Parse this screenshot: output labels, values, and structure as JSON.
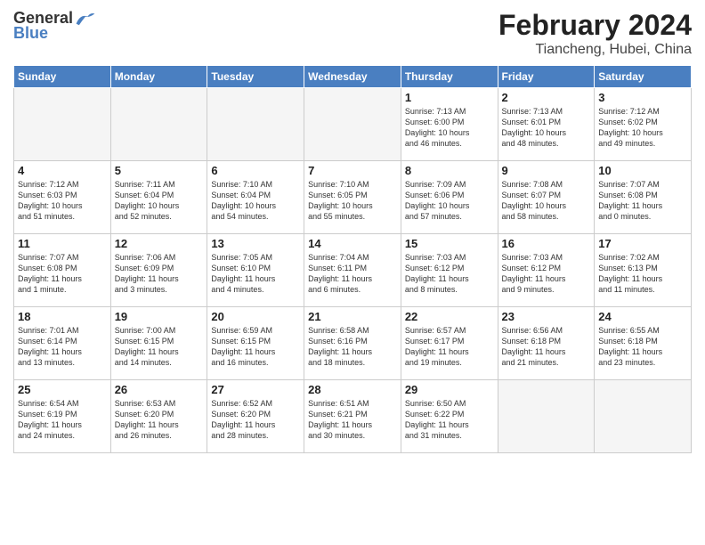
{
  "header": {
    "logo_general": "General",
    "logo_blue": "Blue",
    "month_title": "February 2024",
    "location": "Tiancheng, Hubei, China"
  },
  "weekdays": [
    "Sunday",
    "Monday",
    "Tuesday",
    "Wednesday",
    "Thursday",
    "Friday",
    "Saturday"
  ],
  "weeks": [
    [
      {
        "day": "",
        "info": ""
      },
      {
        "day": "",
        "info": ""
      },
      {
        "day": "",
        "info": ""
      },
      {
        "day": "",
        "info": ""
      },
      {
        "day": "1",
        "info": "Sunrise: 7:13 AM\nSunset: 6:00 PM\nDaylight: 10 hours\nand 46 minutes."
      },
      {
        "day": "2",
        "info": "Sunrise: 7:13 AM\nSunset: 6:01 PM\nDaylight: 10 hours\nand 48 minutes."
      },
      {
        "day": "3",
        "info": "Sunrise: 7:12 AM\nSunset: 6:02 PM\nDaylight: 10 hours\nand 49 minutes."
      }
    ],
    [
      {
        "day": "4",
        "info": "Sunrise: 7:12 AM\nSunset: 6:03 PM\nDaylight: 10 hours\nand 51 minutes."
      },
      {
        "day": "5",
        "info": "Sunrise: 7:11 AM\nSunset: 6:04 PM\nDaylight: 10 hours\nand 52 minutes."
      },
      {
        "day": "6",
        "info": "Sunrise: 7:10 AM\nSunset: 6:04 PM\nDaylight: 10 hours\nand 54 minutes."
      },
      {
        "day": "7",
        "info": "Sunrise: 7:10 AM\nSunset: 6:05 PM\nDaylight: 10 hours\nand 55 minutes."
      },
      {
        "day": "8",
        "info": "Sunrise: 7:09 AM\nSunset: 6:06 PM\nDaylight: 10 hours\nand 57 minutes."
      },
      {
        "day": "9",
        "info": "Sunrise: 7:08 AM\nSunset: 6:07 PM\nDaylight: 10 hours\nand 58 minutes."
      },
      {
        "day": "10",
        "info": "Sunrise: 7:07 AM\nSunset: 6:08 PM\nDaylight: 11 hours\nand 0 minutes."
      }
    ],
    [
      {
        "day": "11",
        "info": "Sunrise: 7:07 AM\nSunset: 6:08 PM\nDaylight: 11 hours\nand 1 minute."
      },
      {
        "day": "12",
        "info": "Sunrise: 7:06 AM\nSunset: 6:09 PM\nDaylight: 11 hours\nand 3 minutes."
      },
      {
        "day": "13",
        "info": "Sunrise: 7:05 AM\nSunset: 6:10 PM\nDaylight: 11 hours\nand 4 minutes."
      },
      {
        "day": "14",
        "info": "Sunrise: 7:04 AM\nSunset: 6:11 PM\nDaylight: 11 hours\nand 6 minutes."
      },
      {
        "day": "15",
        "info": "Sunrise: 7:03 AM\nSunset: 6:12 PM\nDaylight: 11 hours\nand 8 minutes."
      },
      {
        "day": "16",
        "info": "Sunrise: 7:03 AM\nSunset: 6:12 PM\nDaylight: 11 hours\nand 9 minutes."
      },
      {
        "day": "17",
        "info": "Sunrise: 7:02 AM\nSunset: 6:13 PM\nDaylight: 11 hours\nand 11 minutes."
      }
    ],
    [
      {
        "day": "18",
        "info": "Sunrise: 7:01 AM\nSunset: 6:14 PM\nDaylight: 11 hours\nand 13 minutes."
      },
      {
        "day": "19",
        "info": "Sunrise: 7:00 AM\nSunset: 6:15 PM\nDaylight: 11 hours\nand 14 minutes."
      },
      {
        "day": "20",
        "info": "Sunrise: 6:59 AM\nSunset: 6:15 PM\nDaylight: 11 hours\nand 16 minutes."
      },
      {
        "day": "21",
        "info": "Sunrise: 6:58 AM\nSunset: 6:16 PM\nDaylight: 11 hours\nand 18 minutes."
      },
      {
        "day": "22",
        "info": "Sunrise: 6:57 AM\nSunset: 6:17 PM\nDaylight: 11 hours\nand 19 minutes."
      },
      {
        "day": "23",
        "info": "Sunrise: 6:56 AM\nSunset: 6:18 PM\nDaylight: 11 hours\nand 21 minutes."
      },
      {
        "day": "24",
        "info": "Sunrise: 6:55 AM\nSunset: 6:18 PM\nDaylight: 11 hours\nand 23 minutes."
      }
    ],
    [
      {
        "day": "25",
        "info": "Sunrise: 6:54 AM\nSunset: 6:19 PM\nDaylight: 11 hours\nand 24 minutes."
      },
      {
        "day": "26",
        "info": "Sunrise: 6:53 AM\nSunset: 6:20 PM\nDaylight: 11 hours\nand 26 minutes."
      },
      {
        "day": "27",
        "info": "Sunrise: 6:52 AM\nSunset: 6:20 PM\nDaylight: 11 hours\nand 28 minutes."
      },
      {
        "day": "28",
        "info": "Sunrise: 6:51 AM\nSunset: 6:21 PM\nDaylight: 11 hours\nand 30 minutes."
      },
      {
        "day": "29",
        "info": "Sunrise: 6:50 AM\nSunset: 6:22 PM\nDaylight: 11 hours\nand 31 minutes."
      },
      {
        "day": "",
        "info": ""
      },
      {
        "day": "",
        "info": ""
      }
    ]
  ]
}
